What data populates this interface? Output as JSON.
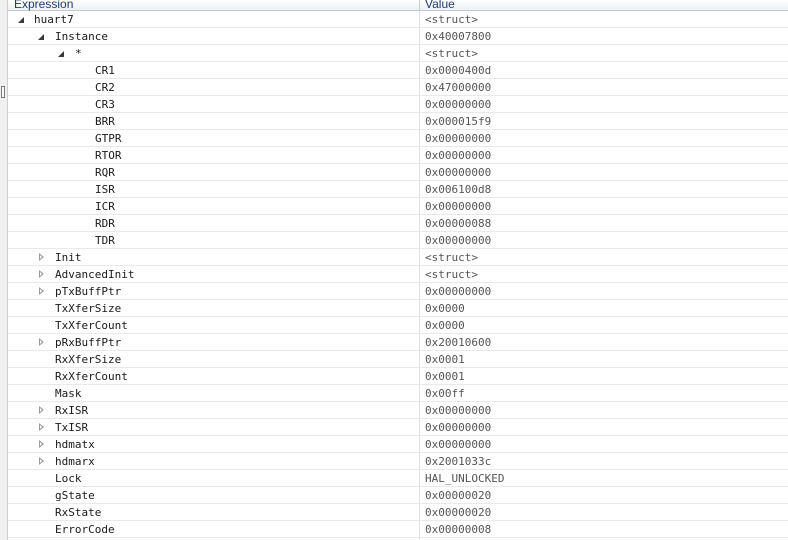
{
  "header": {
    "expression": "Expression",
    "value": "Value"
  },
  "rows": [
    {
      "name": "huart7",
      "value": "<struct>"
    },
    {
      "name": "Instance",
      "value": "0x40007800"
    },
    {
      "name": "*",
      "value": "<struct>"
    },
    {
      "name": "CR1",
      "value": "0x0000400d"
    },
    {
      "name": "CR2",
      "value": "0x47000000"
    },
    {
      "name": "CR3",
      "value": "0x00000000"
    },
    {
      "name": "BRR",
      "value": "0x000015f9"
    },
    {
      "name": "GTPR",
      "value": "0x00000000"
    },
    {
      "name": "RTOR",
      "value": "0x00000000"
    },
    {
      "name": "RQR",
      "value": "0x00000000"
    },
    {
      "name": "ISR",
      "value": "0x006100d8"
    },
    {
      "name": "ICR",
      "value": "0x00000000"
    },
    {
      "name": "RDR",
      "value": "0x00000088"
    },
    {
      "name": "TDR",
      "value": "0x00000000"
    },
    {
      "name": "Init",
      "value": "<struct>"
    },
    {
      "name": "AdvancedInit",
      "value": "<struct>"
    },
    {
      "name": "pTxBuffPtr",
      "value": "0x00000000"
    },
    {
      "name": "TxXferSize",
      "value": "0x0000"
    },
    {
      "name": "TxXferCount",
      "value": "0x0000"
    },
    {
      "name": "pRxBuffPtr",
      "value": "0x20010600"
    },
    {
      "name": "RxXferSize",
      "value": "0x0001"
    },
    {
      "name": "RxXferCount",
      "value": "0x0001"
    },
    {
      "name": "Mask",
      "value": "0x00ff"
    },
    {
      "name": "RxISR",
      "value": "0x00000000"
    },
    {
      "name": "TxISR",
      "value": "0x00000000"
    },
    {
      "name": "hdmatx",
      "value": "0x00000000"
    },
    {
      "name": "hdmarx",
      "value": "0x2001033c"
    },
    {
      "name": "Lock",
      "value": "HAL_UNLOCKED"
    },
    {
      "name": "gState",
      "value": "0x00000020"
    },
    {
      "name": "RxState",
      "value": "0x00000020"
    },
    {
      "name": "ErrorCode",
      "value": "0x00000008"
    }
  ]
}
